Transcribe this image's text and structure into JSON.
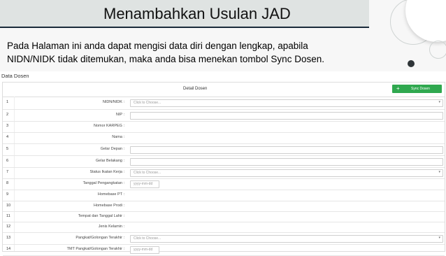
{
  "slide": {
    "title": "Menambahkan Usulan JAD",
    "description": "Pada Halaman ini anda dapat mengisi data diri dengan lengkap, apabila NIDN/NIDK tidak ditemukan, maka anda bisa menekan tombol Sync Dosen."
  },
  "panel": {
    "title": "Data Dosen",
    "header_label": "Detail Dosen",
    "sync_button": "Sync Dosen",
    "sync_icon": "+"
  },
  "rows": [
    {
      "no": "1",
      "label": "NIDN/NIDK :",
      "type": "select",
      "placeholder": "Click to Choose..."
    },
    {
      "no": "2",
      "label": "NIP :",
      "type": "text",
      "placeholder": ""
    },
    {
      "no": "3",
      "label": "Nomor KARPEG :",
      "type": "none",
      "placeholder": ""
    },
    {
      "no": "4",
      "label": "Nama :",
      "type": "none",
      "placeholder": ""
    },
    {
      "no": "5",
      "label": "Gelar Depan :",
      "type": "text",
      "placeholder": ""
    },
    {
      "no": "6",
      "label": "Gelar Belakang :",
      "type": "text",
      "placeholder": ""
    },
    {
      "no": "7",
      "label": "Status Ikatan Kerja :",
      "type": "select",
      "placeholder": "Click to Choose..."
    },
    {
      "no": "8",
      "label": "Tanggal Pengangkatan :",
      "type": "date",
      "placeholder": "yyyy-mm-dd"
    },
    {
      "no": "9",
      "label": "Homebase PT :",
      "type": "none",
      "placeholder": ""
    },
    {
      "no": "10",
      "label": "Homebase Prodi :",
      "type": "none",
      "placeholder": ""
    },
    {
      "no": "11",
      "label": "Tempat dan Tanggal Lahir :",
      "type": "none",
      "placeholder": ""
    },
    {
      "no": "12",
      "label": "Jenis Kelamin :",
      "type": "none",
      "placeholder": ""
    },
    {
      "no": "13",
      "label": "Pangkat/Golongan Terakhir :",
      "type": "select",
      "placeholder": "Click to Choose..."
    },
    {
      "no": "14",
      "label": "TMT Pangkat/Golongan Terakhir :",
      "type": "date",
      "placeholder": "yyyy-mm-dd"
    }
  ]
}
